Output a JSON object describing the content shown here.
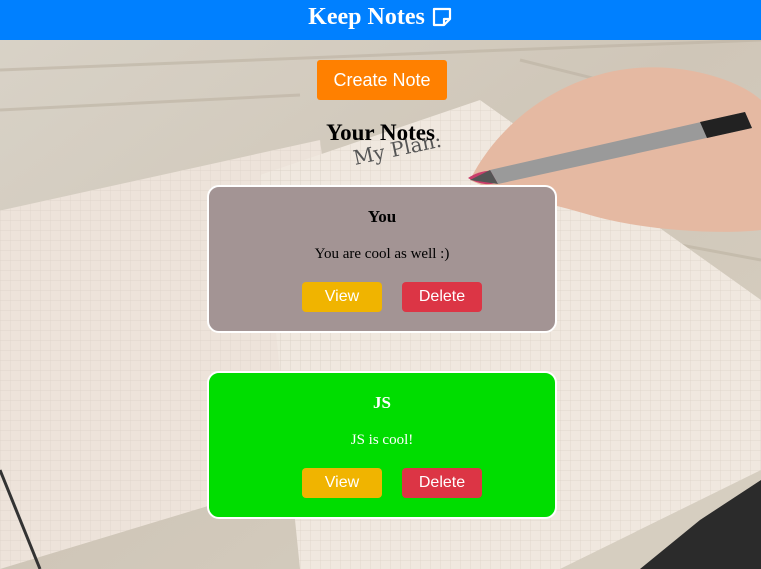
{
  "header": {
    "title": "Keep Notes",
    "icon": "sticky-note-icon",
    "background_color": "#0080ff"
  },
  "main": {
    "create_button_label": "Create Note",
    "create_button_color": "#ff8000",
    "section_title": "Your Notes",
    "notes": [
      {
        "title": "You",
        "body": "You are cool as well :)",
        "color": "#a39494",
        "view_label": "View",
        "delete_label": "Delete"
      },
      {
        "title": "JS",
        "body": "JS is cool!",
        "color": "#00dd00",
        "view_label": "View",
        "delete_label": "Delete"
      }
    ]
  },
  "background": {
    "handwriting": "My Plan:"
  }
}
